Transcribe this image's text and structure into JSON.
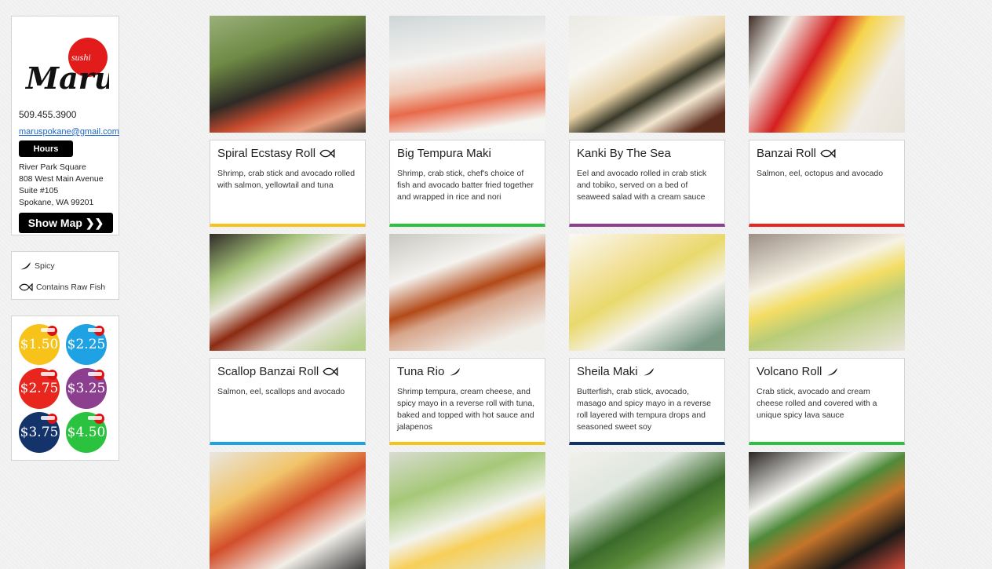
{
  "sidebar": {
    "logo_word": "Maru",
    "logo_sub": "sushi",
    "phone": "509.455.3900",
    "email": "maruspokane@gmail.com",
    "hours_label": "Hours",
    "address": [
      "River Park Square",
      "808 West Main Avenue",
      "Suite #105",
      "Spokane, WA 99201"
    ],
    "map_label": "Show Map ❯❯"
  },
  "legend": {
    "spicy_label": "Spicy",
    "raw_label": "Contains Raw Fish"
  },
  "prices": [
    {
      "label": "$1.50",
      "color": "#f7c31a"
    },
    {
      "label": "$2.25",
      "color": "#1fa2e3"
    },
    {
      "label": "$2.75",
      "color": "#e8261d"
    },
    {
      "label": "$3.25",
      "color": "#8b3f8e"
    },
    {
      "label": "$3.75",
      "color": "#14336b"
    },
    {
      "label": "$4.50",
      "color": "#2bc23f"
    }
  ],
  "menu": [
    {
      "name": "Spiral Ecstasy Roll",
      "icon": "fish-icon",
      "desc": "Shrimp, crab stick and avocado rolled with salmon, yellowtail and tuna",
      "color": "#f7c31a"
    },
    {
      "name": "Big Tempura Maki",
      "icon": "",
      "desc": "Shrimp, crab stick, chef's choice of fish and avocado batter fried together and wrapped in rice and nori",
      "color": "#2bc23f"
    },
    {
      "name": "Kanki By The Sea",
      "icon": "",
      "desc": "Eel and avocado rolled in crab stick and tobiko, served on a bed of seaweed salad with a cream sauce",
      "color": "#8b3f8e"
    },
    {
      "name": "Banzai Roll",
      "icon": "fish-icon",
      "desc": "Salmon, eel, octopus and avocado",
      "color": "#e8261d"
    },
    {
      "name": "Scallop Banzai Roll",
      "icon": "fish-icon",
      "desc": "Salmon, eel, scallops and avocado",
      "color": "#1fa2e3"
    },
    {
      "name": "Tuna Rio",
      "icon": "pepper-icon",
      "desc": "Shrimp tempura, cream cheese, and spicy mayo in a reverse roll with tuna, baked and topped with hot sauce and jalapenos",
      "color": "#f7c31a"
    },
    {
      "name": "Sheila Maki",
      "icon": "pepper-icon",
      "desc": "Butterfish, crab stick, avocado, masago and spicy mayo in a reverse roll layered with tempura drops and seasoned sweet soy",
      "color": "#14336b"
    },
    {
      "name": "Volcano Roll",
      "icon": "pepper-icon",
      "desc": "Crab stick, avocado and cream cheese rolled and covered with a unique spicy lava sauce",
      "color": "#2bc23f"
    },
    {
      "name": "",
      "icon": "",
      "desc": "",
      "color": ""
    },
    {
      "name": "",
      "icon": "",
      "desc": "",
      "color": ""
    },
    {
      "name": "",
      "icon": "",
      "desc": "",
      "color": ""
    },
    {
      "name": "",
      "icon": "",
      "desc": "",
      "color": ""
    }
  ]
}
